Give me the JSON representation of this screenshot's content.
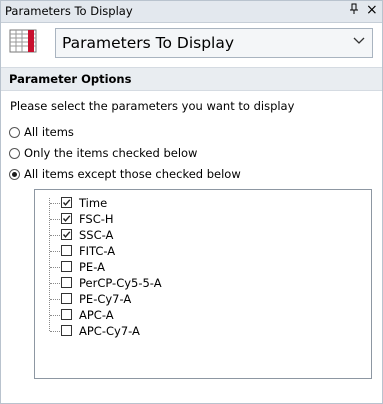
{
  "window": {
    "title": "Parameters To Display",
    "pin_glyph": "⊥",
    "close_glyph": "×"
  },
  "selector": {
    "value": "Parameters To Display",
    "icon": "grid-icon"
  },
  "section": {
    "title": "Parameter Options"
  },
  "instruction": "Please select the parameters you want to display",
  "radios": [
    {
      "label": "All items",
      "checked": false
    },
    {
      "label": "Only the items checked below",
      "checked": false
    },
    {
      "label": "All items except those checked below",
      "checked": true
    }
  ],
  "parameters": [
    {
      "label": "Time",
      "checked": true
    },
    {
      "label": "FSC-H",
      "checked": true
    },
    {
      "label": "SSC-A",
      "checked": true
    },
    {
      "label": "FITC-A",
      "checked": false
    },
    {
      "label": "PE-A",
      "checked": false
    },
    {
      "label": "PerCP-Cy5-5-A",
      "checked": false
    },
    {
      "label": "PE-Cy7-A",
      "checked": false
    },
    {
      "label": "APC-A",
      "checked": false
    },
    {
      "label": "APC-Cy7-A",
      "checked": false
    }
  ],
  "colors": {
    "titlebar_bg": "#e3e8ee",
    "section_bg": "#e9edf1",
    "icon_red": "#c8102e"
  }
}
